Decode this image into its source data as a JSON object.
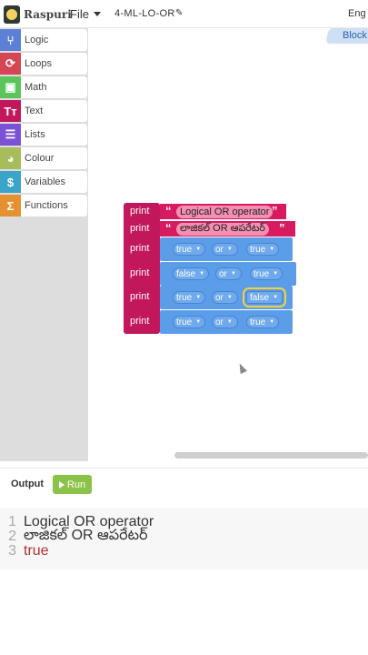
{
  "header": {
    "logo_text": "Raspuri",
    "file_menu": "File",
    "project_title": "4-ML-LO-OR",
    "language": "Eng"
  },
  "sidebar": {
    "items": [
      {
        "label": "Logic",
        "icon": "logic-icon",
        "color": "#5b80d6"
      },
      {
        "label": "Loops",
        "icon": "loop-icon",
        "color": "#d64553"
      },
      {
        "label": "Math",
        "icon": "math-icon",
        "color": "#5bc45b"
      },
      {
        "label": "Text",
        "icon": "text-icon",
        "color": "#c2185b"
      },
      {
        "label": "Lists",
        "icon": "list-icon",
        "color": "#7b52d6"
      },
      {
        "label": "Colour",
        "icon": "palette-icon",
        "color": "#a5be5b"
      },
      {
        "label": "Variables",
        "icon": "variables-icon",
        "color": "#3ba4c9"
      },
      {
        "label": "Functions",
        "icon": "functions-icon",
        "color": "#e6912f"
      }
    ]
  },
  "workspace": {
    "tab_label": "Block",
    "blocks": [
      {
        "keyword": "print",
        "type": "text",
        "value": "Logical OR operator"
      },
      {
        "keyword": "print",
        "type": "text",
        "value": "లాజికల్ OR ఆపరేటర్"
      },
      {
        "keyword": "print",
        "type": "or",
        "left": "true",
        "op": "or",
        "right": "true"
      },
      {
        "keyword": "print",
        "type": "or",
        "left": "false",
        "op": "or",
        "right": "true"
      },
      {
        "keyword": "print",
        "type": "or",
        "left": "true",
        "op": "or",
        "right": "false"
      },
      {
        "keyword": "print",
        "type": "or",
        "left": "true",
        "op": "or",
        "right": "true"
      }
    ]
  },
  "output": {
    "label": "Output",
    "run_label": "Run",
    "lines": [
      {
        "num": "1",
        "text": "Logical OR operator"
      },
      {
        "num": "2",
        "text": "లాజికల్ OR ఆపరేటర్"
      },
      {
        "num": "3",
        "text": "true"
      }
    ]
  },
  "colors": {
    "print_block": "#c2185b",
    "logic_block": "#5b9de8",
    "run_button": "#8bc34a"
  }
}
